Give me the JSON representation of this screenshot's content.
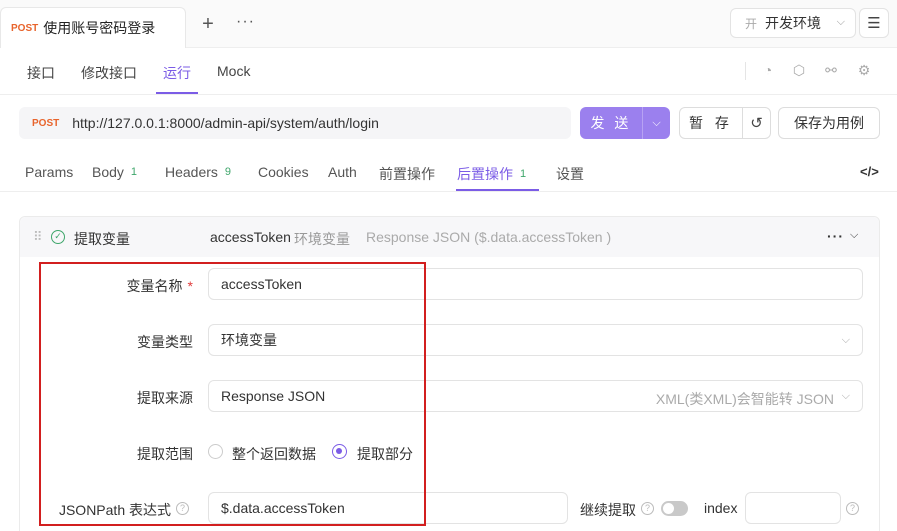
{
  "top_tab": {
    "method": "POST",
    "title": "使用账号密码登录"
  },
  "top_actions": {
    "plus": "+",
    "more": "···"
  },
  "env": {
    "badge": "开",
    "label": "开发环境"
  },
  "subtabs": [
    "接口",
    "修改接口",
    "运行",
    "Mock"
  ],
  "active_subtab": "运行",
  "request": {
    "method": "POST",
    "url": "http://127.0.0.1:8000/admin-api/system/auth/login",
    "send_label": "发 送",
    "save_label": "暂 存",
    "save_as_label": "保存为用例"
  },
  "param_tabs": [
    {
      "label": "Params",
      "count": ""
    },
    {
      "label": "Body",
      "count": "1"
    },
    {
      "label": "Headers",
      "count": "9"
    },
    {
      "label": "Cookies",
      "count": ""
    },
    {
      "label": "Auth",
      "count": ""
    },
    {
      "label": "前置操作",
      "count": ""
    },
    {
      "label": "后置操作",
      "count": "1"
    },
    {
      "label": "设置",
      "count": ""
    }
  ],
  "active_param_tab": "后置操作",
  "card": {
    "title": "提取变量",
    "var_name": "accessToken",
    "env": "环境变量",
    "source_summary": "Response JSON ($.data.accessToken )"
  },
  "form": {
    "var_name_label": "变量名称",
    "required_mark": "*",
    "var_name_value": "accessToken",
    "var_type_label": "变量类型",
    "var_type_value": "环境变量",
    "source_label": "提取来源",
    "source_value": "Response JSON",
    "source_hint": "XML(类XML)会智能转 JSON",
    "scope_label": "提取范围",
    "scope_option_all": "整个返回数据",
    "scope_option_part": "提取部分",
    "scope_selected": "提取部分",
    "jsonpath_label": "JSONPath 表达式",
    "jsonpath_value": "$.data.accessToken",
    "continue_label": "继续提取",
    "continue_enabled": false,
    "index_label": "index",
    "index_value": ""
  },
  "colors": {
    "accent": "#7b5ce6",
    "method": "#e8642c",
    "count": "#3fa66b",
    "highlight": "#d21f1f"
  }
}
